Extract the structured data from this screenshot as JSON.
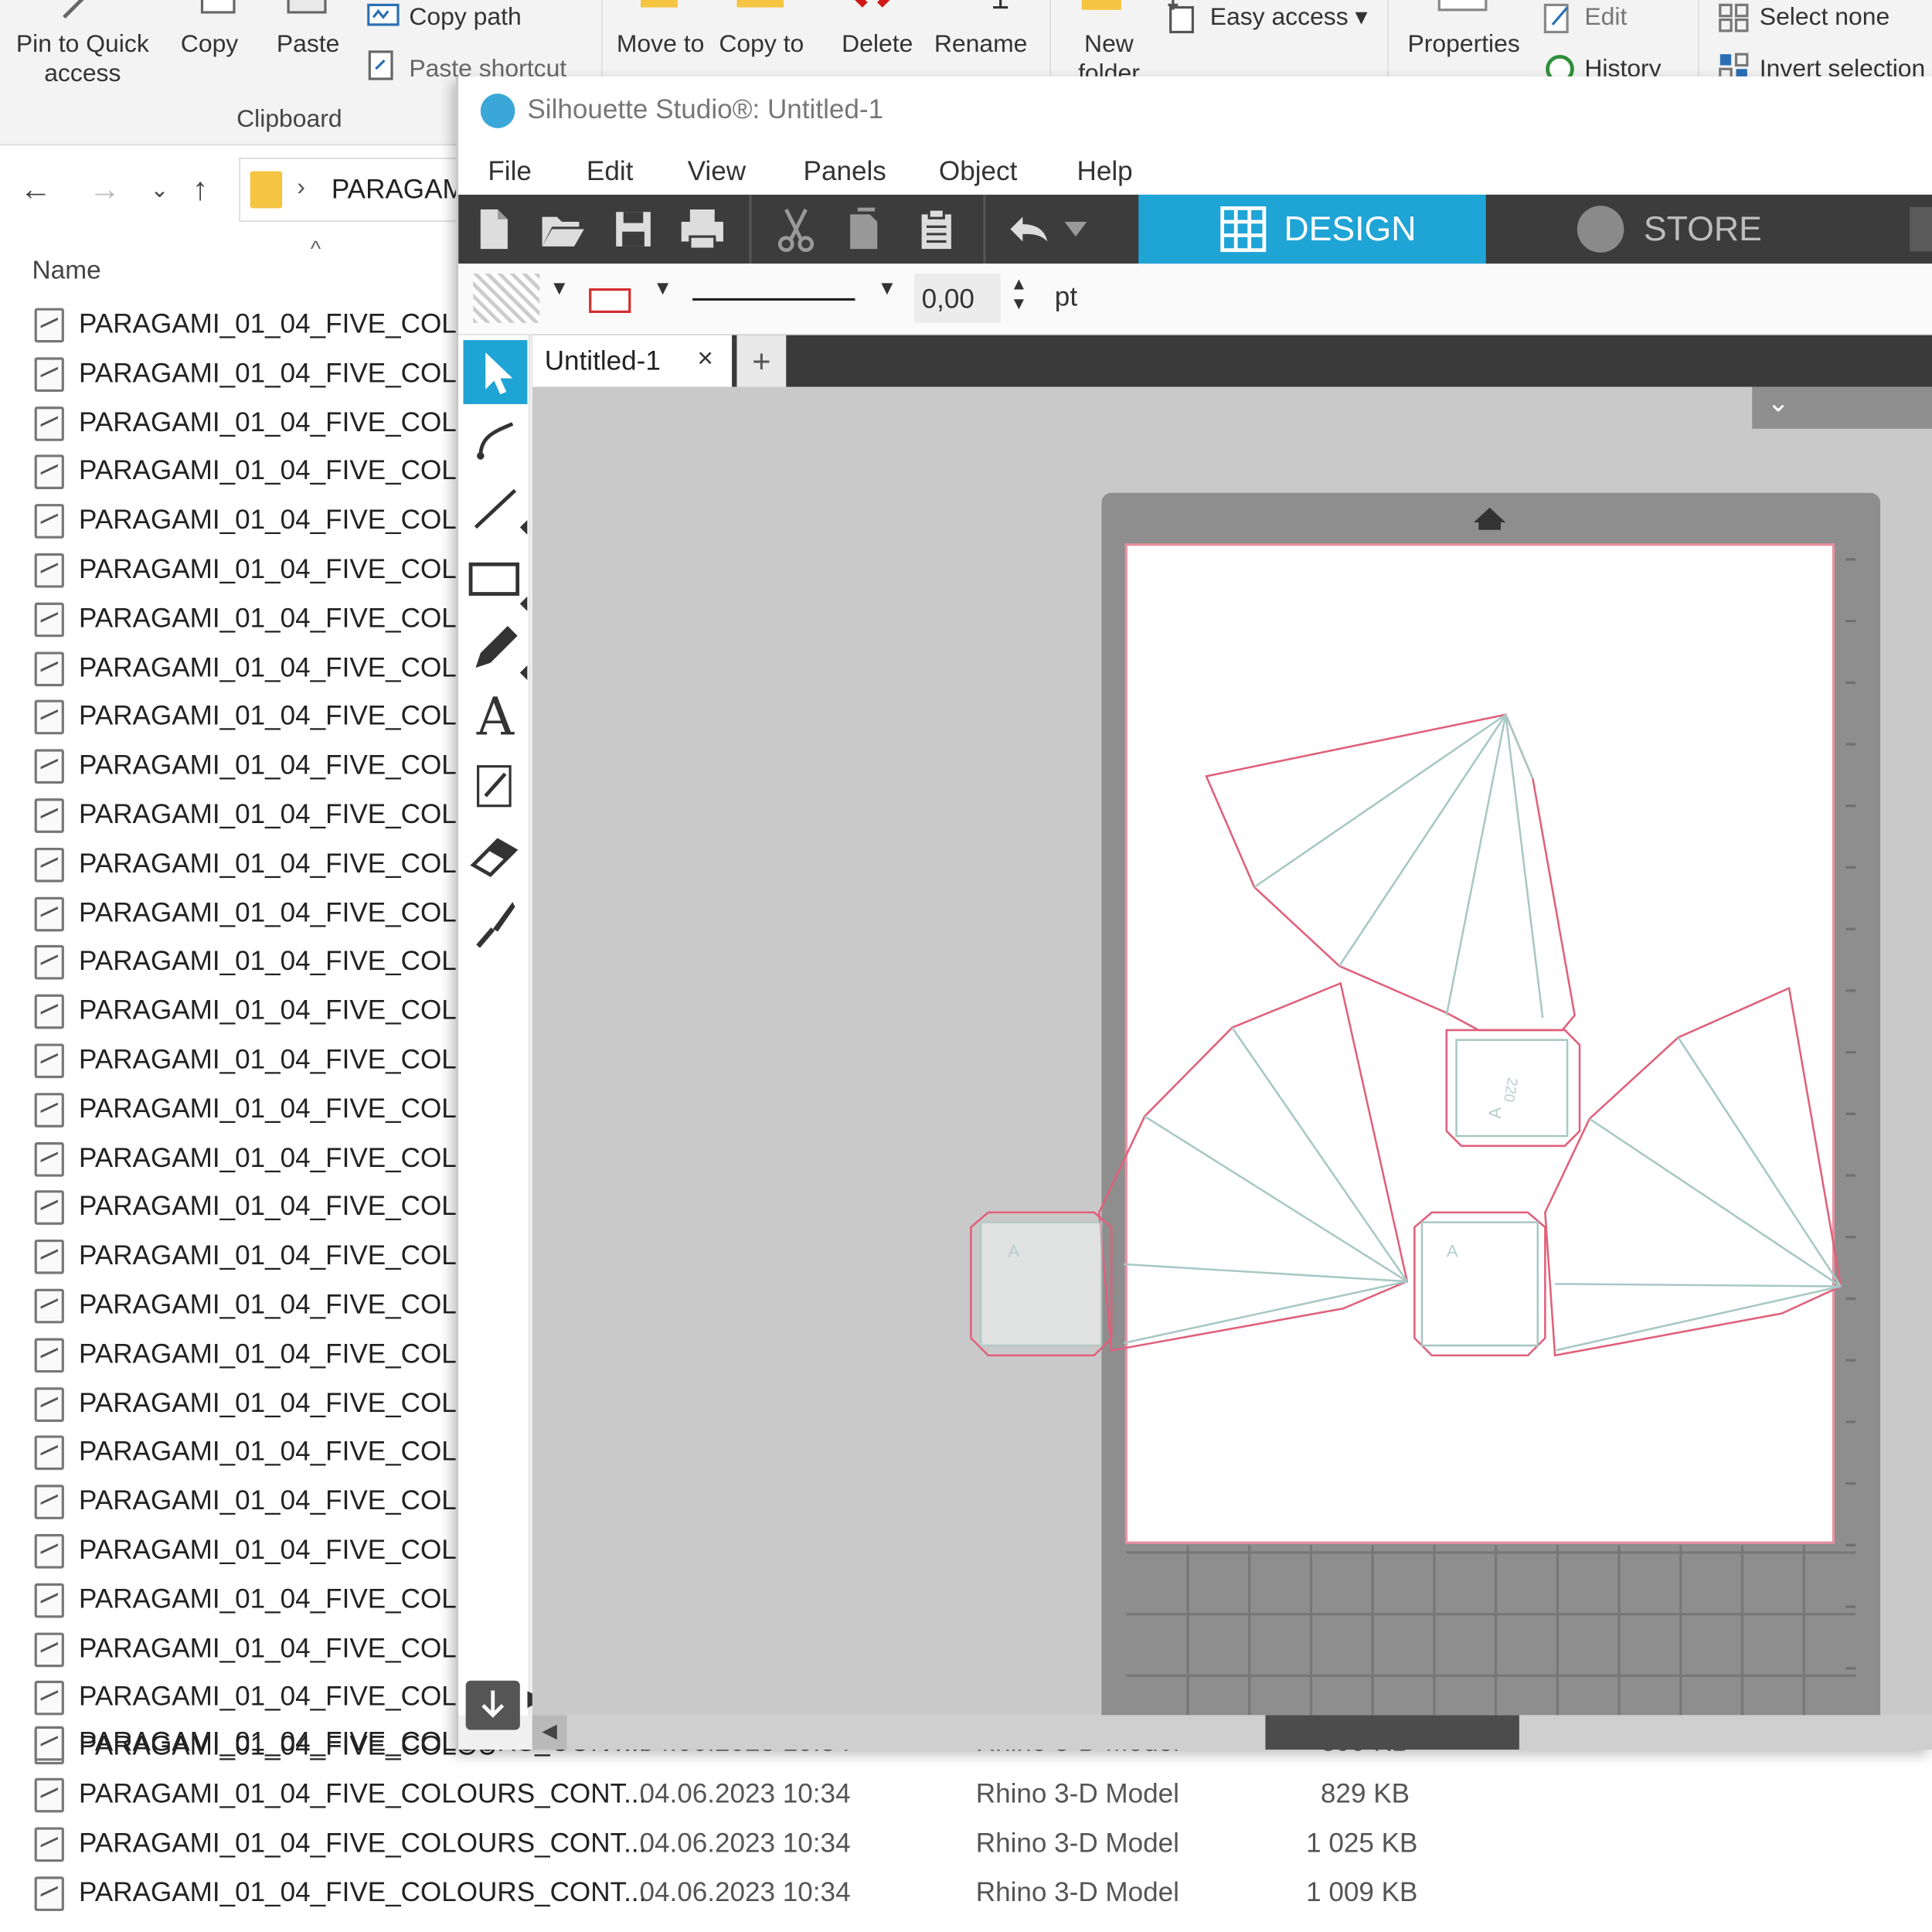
{
  "explorer": {
    "ribbon": {
      "pin_label": "Pin to Quick access",
      "copy_label": "Copy",
      "paste_label": "Paste",
      "copy_path_label": "Copy path",
      "paste_shortcut_label": "Paste shortcut",
      "clipboard_group": "Clipboard",
      "move_to_label": "Move to",
      "copy_to_label": "Copy to",
      "delete_label": "Delete",
      "rename_label": "Rename",
      "new_folder_label": "New folder",
      "easy_access_label": "Easy access",
      "properties_label": "Properties",
      "edit_label": "Edit",
      "history_label": "History",
      "select_none_label": "Select none",
      "invert_selection_label": "Invert selection"
    },
    "address": {
      "path_segment": "PARAGAMI"
    },
    "column_name": "Name",
    "file_name_truncated": "PARAGAMI_01_04_FIVE_COLOU",
    "file_rows_visible_count": 30,
    "bottom_rows": [
      {
        "name": "PARAGAMI_01_04_FIVE_COLOURS_CONT...",
        "date": "04.06.2023 10:34",
        "type": "Rhino 3-D Model",
        "size": "829 KB"
      },
      {
        "name": "PARAGAMI_01_04_FIVE_COLOURS_CONT...",
        "date": "04.06.2023 10:34",
        "type": "Rhino 3-D Model",
        "size": "1 025 KB"
      },
      {
        "name": "PARAGAMI_01_04_FIVE_COLOURS_CONT...",
        "date": "04.06.2023 10:34",
        "type": "Rhino 3-D Model",
        "size": "1 009 KB"
      }
    ],
    "partial_row": {
      "name": "PARAGAMI_01_04_FIVE_COLOURS_CONT...",
      "date": "04.06.2023 10:34",
      "type": "Rhino 3-D Model",
      "size": "899 KB"
    }
  },
  "silhouette": {
    "title": "Silhouette Studio®: Untitled-1",
    "menu": [
      "File",
      "Edit",
      "View",
      "Panels",
      "Object",
      "Help"
    ],
    "design_tab": "DESIGN",
    "store_tab": "STORE",
    "line_width_value": "0,00",
    "line_width_unit": "pt",
    "doc_tab": "Untitled-1",
    "colors": {
      "accent": "#1fa4d6",
      "cut_line": "#e0607a",
      "fold_line": "#a8c8c4",
      "toolbar_bg": "#3c3c3c"
    },
    "icons": {
      "new": "new-document-icon",
      "open": "open-folder-icon",
      "save": "save-icon",
      "print": "print-icon",
      "cut": "scissors-icon",
      "copy": "copy-icon",
      "paste": "clipboard-icon",
      "undo": "undo-icon"
    },
    "tools": [
      "select-tool",
      "point-edit-tool",
      "line-tool",
      "rectangle-tool",
      "pencil-tool",
      "text-tool",
      "trace-tool",
      "eraser-tool",
      "knife-tool"
    ]
  }
}
